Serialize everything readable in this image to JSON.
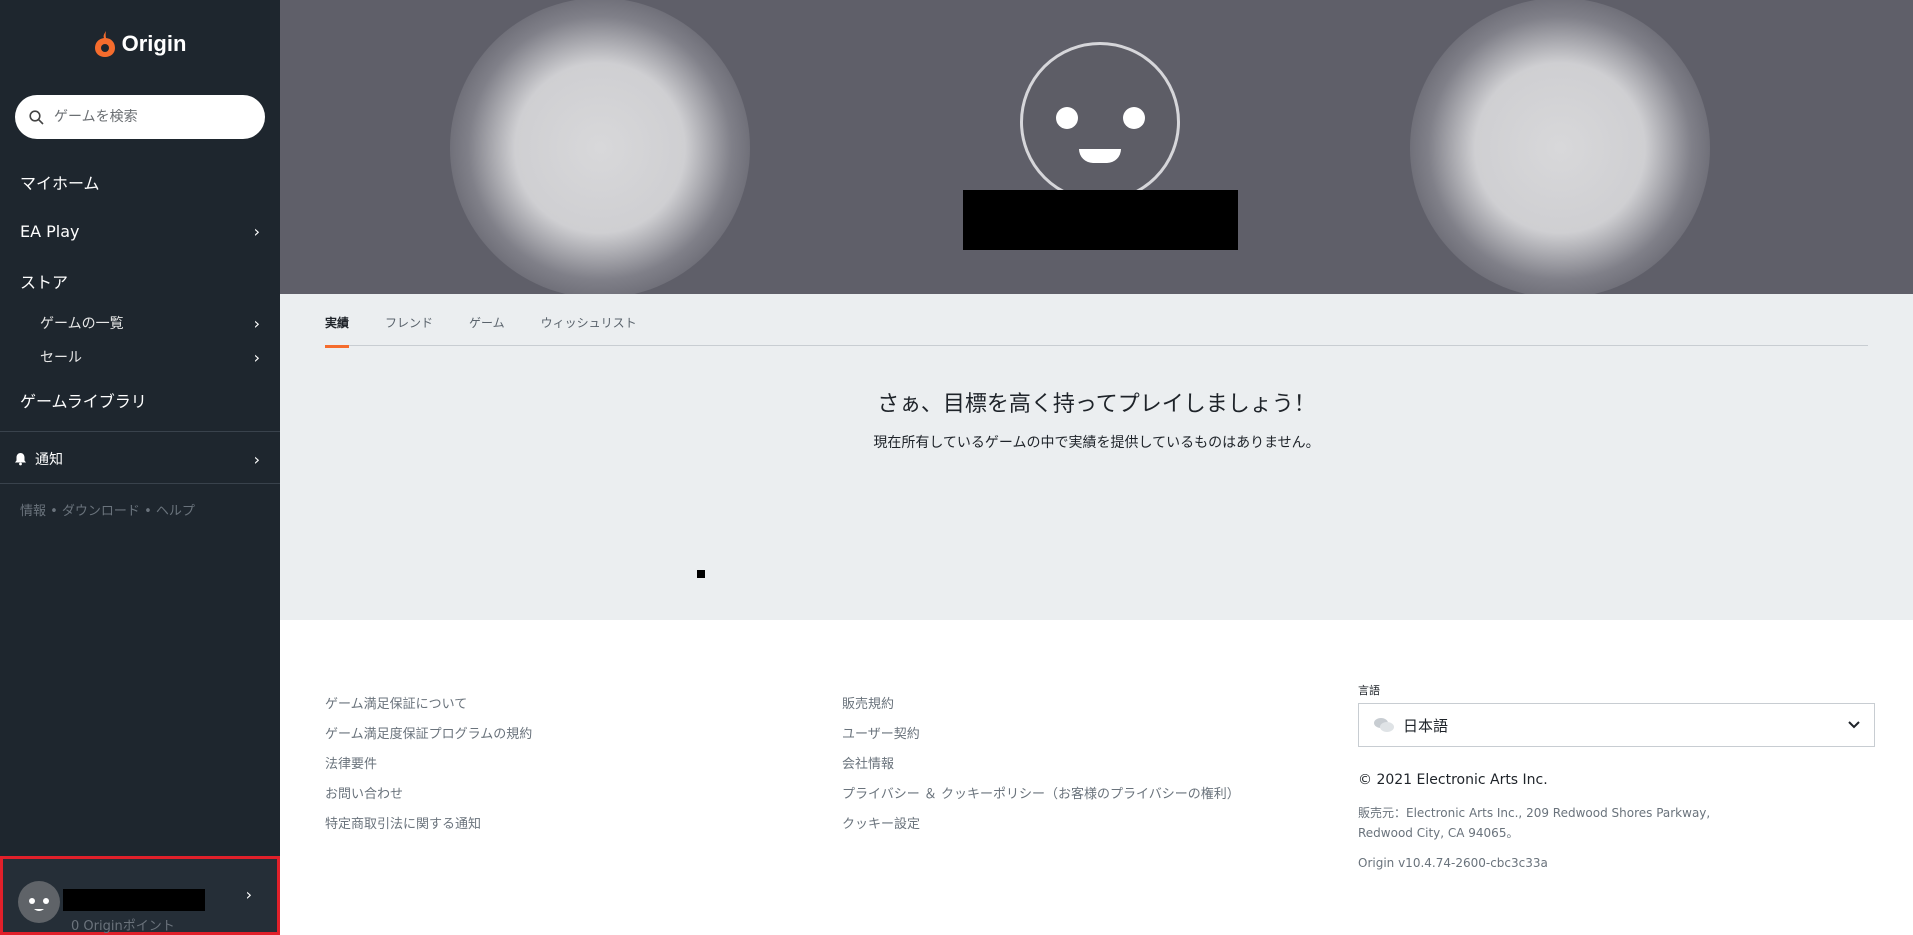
{
  "app": {
    "brand": "Origin",
    "accent_color": "#f56c2d"
  },
  "search": {
    "placeholder": "ゲームを検索"
  },
  "nav": {
    "my_home": "マイホーム",
    "ea_play": "EA Play",
    "store": "ストア",
    "game_list": "ゲームの一覧",
    "sale": "セール",
    "game_library": "ゲームライブラリ",
    "notifications": "通知",
    "info_links": "情報 • ダウンロード • ヘルプ"
  },
  "user": {
    "points": "0 Originポイント"
  },
  "profile": {
    "tabs": [
      "実績",
      "フレンド",
      "ゲーム",
      "ウィッシュリスト"
    ],
    "empty_title": "さぁ、目標を高く持ってプレイしましょう！",
    "empty_subtitle": "現在所有しているゲームの中で実績を提供しているものはありません。"
  },
  "footer": {
    "col1": [
      "ゲーム満足保証について",
      "ゲーム満足度保証プログラムの規約",
      "法律要件",
      "お問い合わせ",
      "特定商取引法に関する通知"
    ],
    "col2": [
      "販売規約",
      "ユーザー契約",
      "会社情報",
      "プライバシー ＆ クッキーポリシー（お客様のプライバシーの権利）",
      "クッキー設定"
    ],
    "language_label": "言語",
    "language_value": "日本語",
    "copyright": "© 2021 Electronic Arts Inc.",
    "seller_line1": "販売元：Electronic Arts Inc., 209 Redwood Shores Parkway,",
    "seller_line2": "Redwood City, CA 94065。",
    "version": "Origin v10.4.74-2600-cbc3c33a"
  }
}
